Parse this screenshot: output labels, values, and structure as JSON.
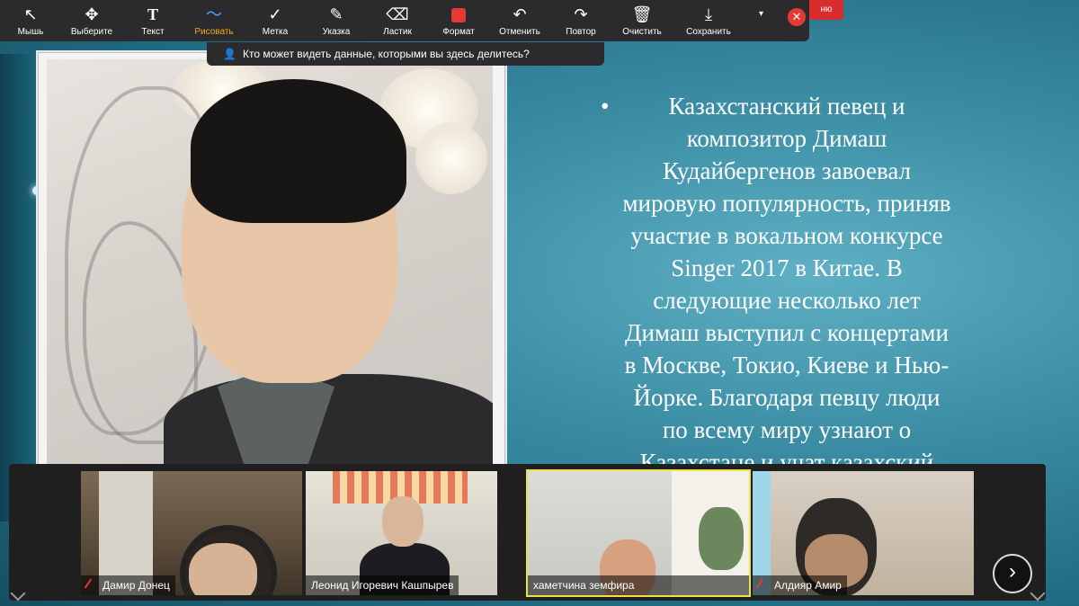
{
  "toolbar": {
    "tools": [
      {
        "label": "Мышь",
        "icon": "cursor-icon"
      },
      {
        "label": "Выберите",
        "icon": "move-icon"
      },
      {
        "label": "Текст",
        "icon": "text-icon"
      },
      {
        "label": "Рисовать",
        "icon": "draw-icon",
        "active": true
      },
      {
        "label": "Метка",
        "icon": "checkmark-icon"
      },
      {
        "label": "Указка",
        "icon": "spotlight-icon"
      },
      {
        "label": "Ластик",
        "icon": "eraser-icon"
      },
      {
        "label": "Формат",
        "icon": "format-swatch-icon"
      },
      {
        "label": "Отменить",
        "icon": "undo-icon"
      },
      {
        "label": "Повтор",
        "icon": "redo-icon"
      },
      {
        "label": "Очистить",
        "icon": "trash-icon"
      },
      {
        "label": "Сохранить",
        "icon": "save-icon"
      }
    ],
    "red_tab_label": "ню",
    "colors": {
      "format_swatch": "#e53935",
      "active_label": "#f5a623",
      "close": "#e53935"
    }
  },
  "share_notice": {
    "text": "Кто может видеть данные, которыми вы здесь делитесь?"
  },
  "slide": {
    "bullet": "•",
    "text": "Казахстанский певец и\nкомпозитор Димаш\nКудайбергенов завоевал\nмировую популярность, приняв\nучастие в вокальном конкурсе\nSinger 2017 в Китае. В\nследующие несколько лет\nДимаш выступил с концертами\nв Москве, Токио, Киеве и Нью-\nЙорке. Благодаря певцу люди\nпо всему миру узнают о\nКазахстане и учат казахский"
  },
  "participants": [
    {
      "name": "Дамир Донец",
      "muted": true
    },
    {
      "name": "Леонид Игоревич Кашпырев",
      "muted": false
    },
    {
      "name": "хаметчина земфира",
      "muted": false,
      "active_speaker": true
    },
    {
      "name": "Алдияр Амир",
      "muted": true
    }
  ],
  "next_arrow": "›"
}
